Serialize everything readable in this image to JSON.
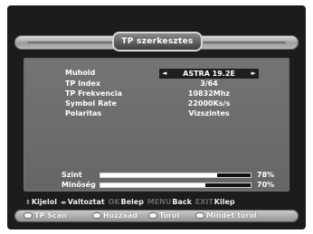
{
  "title": "TP szerkesztes",
  "fields": [
    {
      "label": "Muhold",
      "value": "ASTRA 19.2E",
      "selected": true
    },
    {
      "label": "TP Index",
      "value": "3/64"
    },
    {
      "label": "TP Frekvencia",
      "value": "10832Mhz"
    },
    {
      "label": "Symbol Rate",
      "value": "22000Ks/s"
    },
    {
      "label": "Polaritas",
      "value": "Vizszintes"
    }
  ],
  "arrows": {
    "left": "◄",
    "right": "►"
  },
  "levels": [
    {
      "label": "Szint",
      "percent_text": "78%",
      "percent": 78
    },
    {
      "label": "Minőség",
      "percent_text": "70%",
      "percent": 70
    }
  ],
  "hints": [
    {
      "glyph": "⇕",
      "text": "Kijelol",
      "dim": false
    },
    {
      "glyph": "◂▸",
      "text": "Valtoztat",
      "dim": false
    },
    {
      "glyph": "",
      "text": "OK",
      "dim": true
    },
    {
      "glyph": "",
      "text": "Belep",
      "dim": false
    },
    {
      "glyph": "",
      "text": "MENU",
      "dim": true
    },
    {
      "glyph": "",
      "text": "Back",
      "dim": false
    },
    {
      "glyph": "",
      "text": "EXIT",
      "dim": true
    },
    {
      "glyph": "",
      "text": "Kilep",
      "dim": false
    }
  ],
  "color_buttons": [
    {
      "label": "TP Scan",
      "color": "red"
    },
    {
      "label": "Hozzaad",
      "color": "green"
    },
    {
      "label": "Torol",
      "color": "yellow"
    },
    {
      "label": "Mindet torol",
      "color": "blue"
    }
  ]
}
